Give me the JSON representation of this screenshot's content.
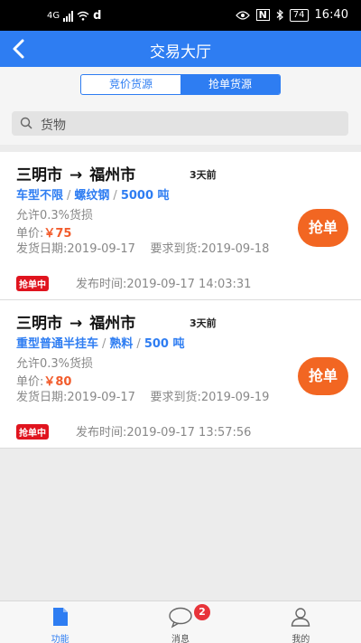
{
  "status_bar": {
    "network": "4G",
    "carrier_glyph": "d",
    "battery": "74",
    "time": "16:40"
  },
  "header": {
    "title": "交易大厅"
  },
  "segments": {
    "bid_tab": "竞价货源",
    "grab_tab": "抢单货源",
    "active": "grab_tab"
  },
  "search": {
    "placeholder": "货物"
  },
  "orders": [
    {
      "from": "三明市",
      "arrow": "→",
      "to": "福州市",
      "ago": "3天前",
      "truck": "车型不限",
      "cargo": "螺纹钢",
      "weight": "5000 吨",
      "loss": "允许0.3%货损",
      "price_label": "单价:",
      "price": "￥75",
      "ship_date": "发货日期:2019-09-17",
      "arrive_date": "要求到货:2019-09-18",
      "badge": "抢单中",
      "publish_time": "发布时间:2019-09-17 14:03:31",
      "action": "抢单"
    },
    {
      "from": "三明市",
      "arrow": "→",
      "to": "福州市",
      "ago": "3天前",
      "truck": "重型普通半挂车",
      "cargo": "熟料",
      "weight": "500 吨",
      "loss": "允许0.3%货损",
      "price_label": "单价:",
      "price": "￥80",
      "ship_date": "发货日期:2019-09-17",
      "arrive_date": "要求到货:2019-09-19",
      "badge": "抢单中",
      "publish_time": "发布时间:2019-09-17 13:57:56",
      "action": "抢单"
    }
  ],
  "tabbar": {
    "items": [
      {
        "label": "功能",
        "icon": "document-icon",
        "active": true
      },
      {
        "label": "消息",
        "icon": "chat-bubble-icon",
        "badge": "2"
      },
      {
        "label": "我的",
        "icon": "person-icon"
      }
    ]
  },
  "colors": {
    "primary": "#2e7df2",
    "price": "#f25c2c",
    "grab_button": "#f26622",
    "badge": "#e0141e"
  }
}
